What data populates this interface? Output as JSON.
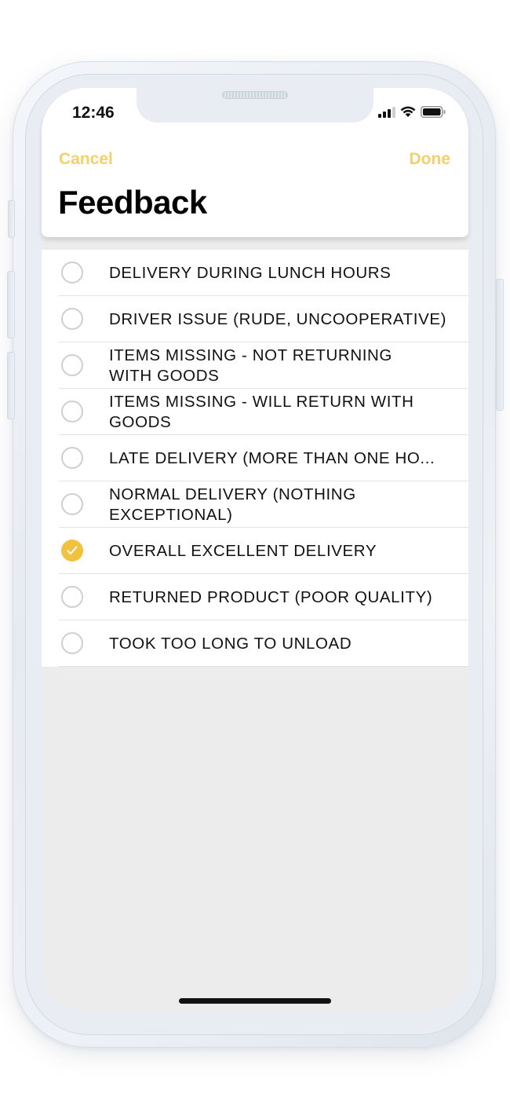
{
  "status_bar": {
    "time": "12:46"
  },
  "nav": {
    "cancel_label": "Cancel",
    "done_label": "Done",
    "title": "Feedback"
  },
  "colors": {
    "accent": "#f2d06b",
    "checked": "#f0c240",
    "list_background": "#ffffff",
    "screen_background": "#ececec"
  },
  "options": [
    {
      "label": "DELIVERY DURING LUNCH HOURS",
      "checked": false
    },
    {
      "label": "DRIVER ISSUE (RUDE, UNCOOPERATIVE)",
      "checked": false
    },
    {
      "label": "ITEMS MISSING - NOT RETURNING WITH GOODS",
      "checked": false
    },
    {
      "label": "ITEMS MISSING - WILL RETURN WITH GOODS",
      "checked": false
    },
    {
      "label": "LATE DELIVERY (MORE THAN ONE HO...",
      "checked": false
    },
    {
      "label": "NORMAL DELIVERY (NOTHING EXCEPTIONAL)",
      "checked": false
    },
    {
      "label": "OVERALL EXCELLENT DELIVERY",
      "checked": true
    },
    {
      "label": "RETURNED PRODUCT (POOR QUALITY)",
      "checked": false
    },
    {
      "label": "TOOK TOO LONG TO UNLOAD",
      "checked": false
    }
  ]
}
